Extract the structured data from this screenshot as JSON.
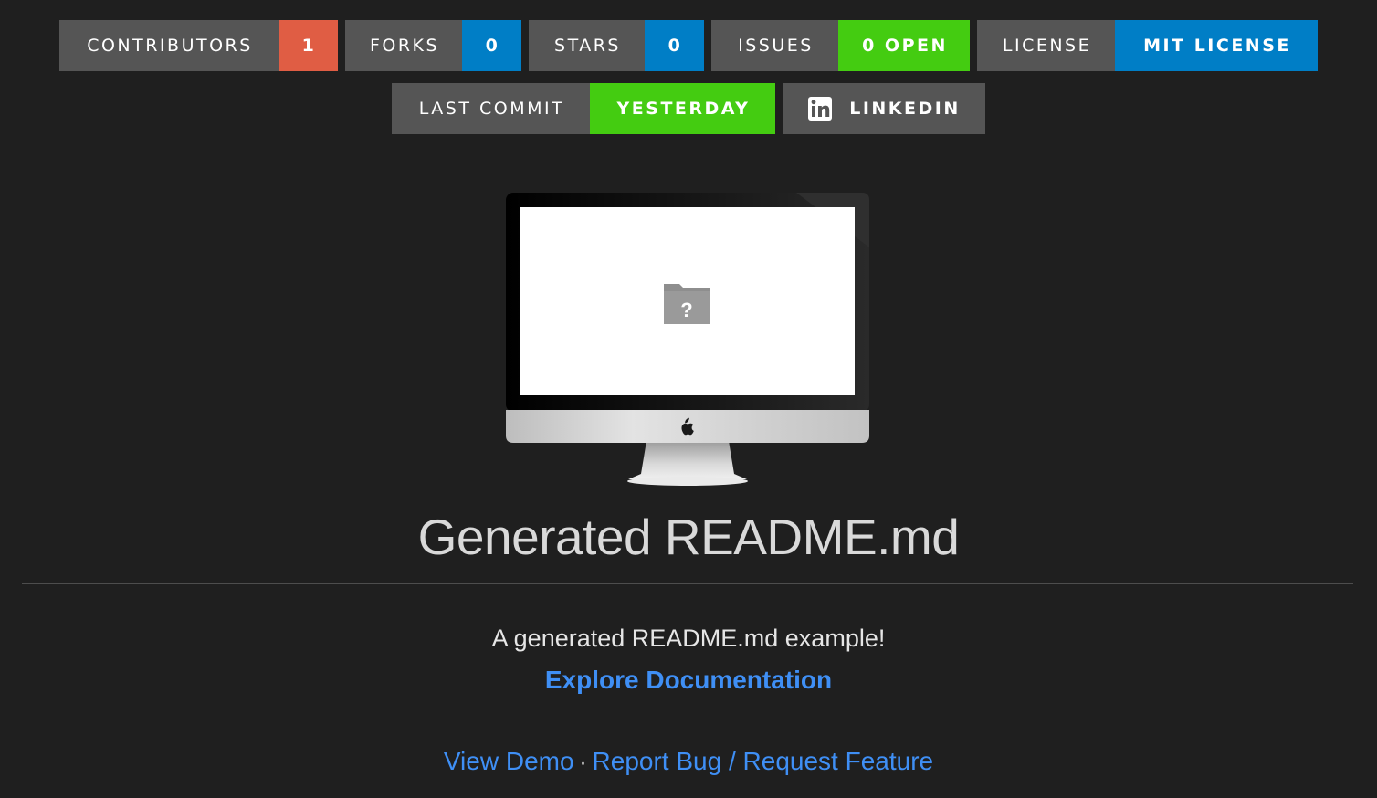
{
  "badges": {
    "contributors": {
      "label": "CONTRIBUTORS",
      "message": "1",
      "color": "#e05d44"
    },
    "forks": {
      "label": "FORKS",
      "message": "0",
      "color": "#007ec6"
    },
    "stars": {
      "label": "STARS",
      "message": "0",
      "color": "#007ec6"
    },
    "issues": {
      "label": "ISSUES",
      "message": "0 OPEN",
      "color": "#44cc11"
    },
    "license": {
      "label": "LICENSE",
      "message": "MIT LICENSE",
      "color": "#007ec6"
    },
    "last_commit": {
      "label": "LAST COMMIT",
      "message": "YESTERDAY",
      "color": "#44cc11"
    },
    "linkedin": {
      "label": "LINKEDIN",
      "icon": "linkedin-icon"
    }
  },
  "hero_image": {
    "icon": "missing-image-folder-icon",
    "device": "imac-monitor"
  },
  "title": "Generated README.md",
  "description": "A generated README.md example!",
  "docs_link": "Explore Documentation",
  "links": {
    "demo": "View Demo",
    "separator": "·",
    "bug": "Report Bug / Request Feature"
  },
  "colors": {
    "background": "#1f1f1f",
    "link": "#3f8ff5",
    "badge_label_bg": "#555555"
  }
}
